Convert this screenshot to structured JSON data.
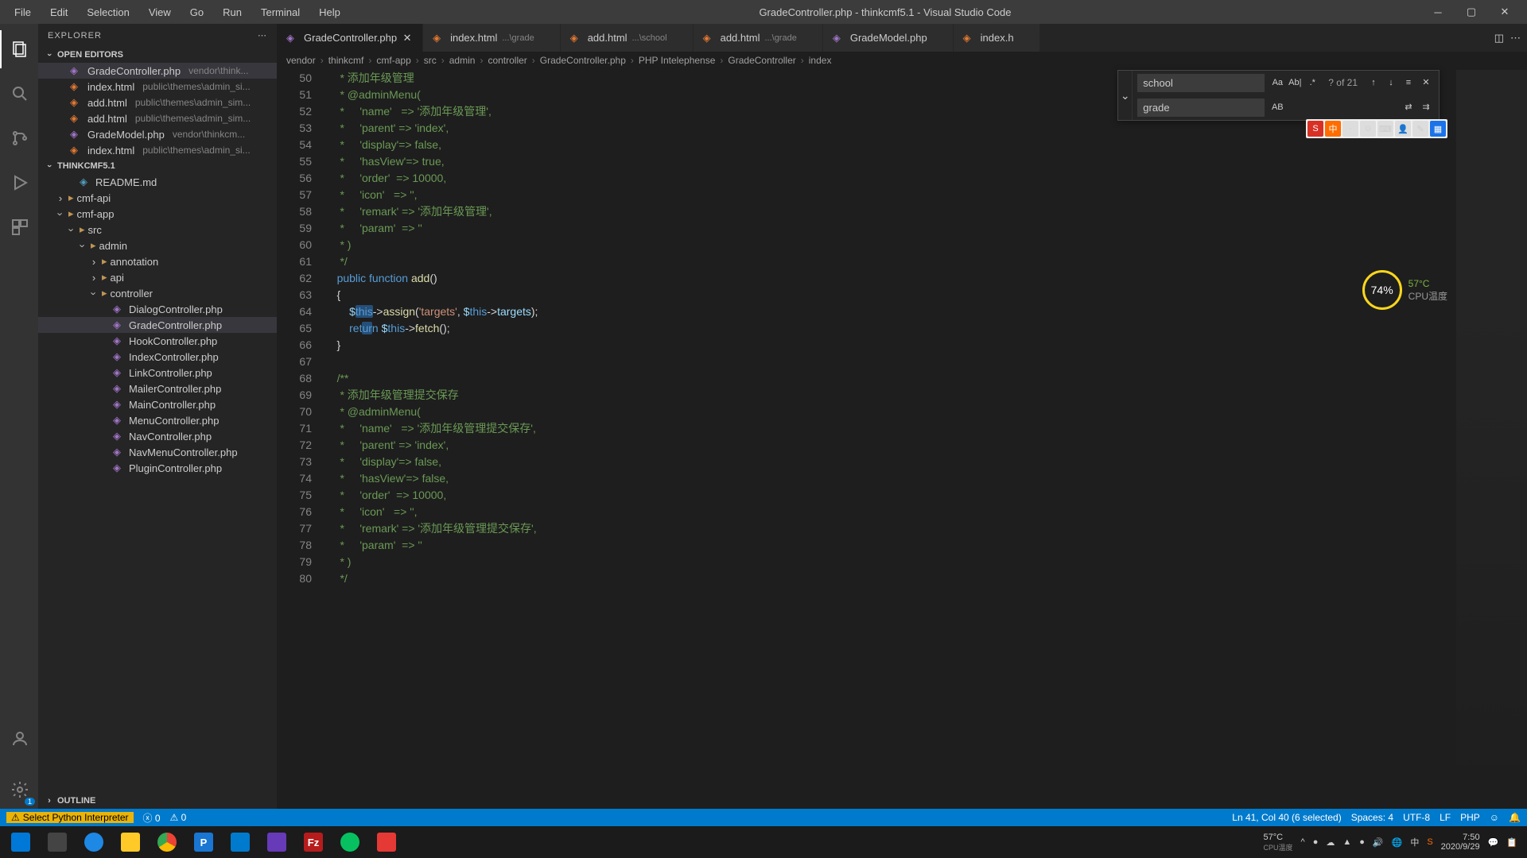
{
  "menubar": [
    "File",
    "Edit",
    "Selection",
    "View",
    "Go",
    "Run",
    "Terminal",
    "Help"
  ],
  "title": "GradeController.php - thinkcmf5.1 - Visual Studio Code",
  "explorer": {
    "header": "EXPLORER",
    "openEditors": "OPEN EDITORS",
    "workspace": "THINKCMF5.1",
    "outline": "OUTLINE",
    "editors": [
      {
        "name": "GradeController.php",
        "path": "vendor\\think...",
        "icon": "php",
        "active": true
      },
      {
        "name": "index.html",
        "path": "public\\themes\\admin_si...",
        "icon": "html"
      },
      {
        "name": "add.html",
        "path": "public\\themes\\admin_sim...",
        "icon": "html"
      },
      {
        "name": "add.html",
        "path": "public\\themes\\admin_sim...",
        "icon": "html"
      },
      {
        "name": "GradeModel.php",
        "path": "vendor\\thinkcm...",
        "icon": "php"
      },
      {
        "name": "index.html",
        "path": "public\\themes\\admin_si...",
        "icon": "html"
      }
    ],
    "tree": [
      {
        "depth": 2,
        "type": "file",
        "name": "README.md",
        "icon": "md"
      },
      {
        "depth": 1,
        "type": "folder",
        "name": "cmf-api",
        "open": false
      },
      {
        "depth": 1,
        "type": "folder",
        "name": "cmf-app",
        "open": true
      },
      {
        "depth": 2,
        "type": "folder",
        "name": "src",
        "open": true
      },
      {
        "depth": 3,
        "type": "folder",
        "name": "admin",
        "open": true
      },
      {
        "depth": 4,
        "type": "folder",
        "name": "annotation",
        "open": false
      },
      {
        "depth": 4,
        "type": "folder",
        "name": "api",
        "open": false
      },
      {
        "depth": 4,
        "type": "folder",
        "name": "controller",
        "open": true
      },
      {
        "depth": 5,
        "type": "file",
        "name": "DialogController.php",
        "icon": "php"
      },
      {
        "depth": 5,
        "type": "file",
        "name": "GradeController.php",
        "icon": "php",
        "selected": true
      },
      {
        "depth": 5,
        "type": "file",
        "name": "HookController.php",
        "icon": "php"
      },
      {
        "depth": 5,
        "type": "file",
        "name": "IndexController.php",
        "icon": "php"
      },
      {
        "depth": 5,
        "type": "file",
        "name": "LinkController.php",
        "icon": "php"
      },
      {
        "depth": 5,
        "type": "file",
        "name": "MailerController.php",
        "icon": "php"
      },
      {
        "depth": 5,
        "type": "file",
        "name": "MainController.php",
        "icon": "php"
      },
      {
        "depth": 5,
        "type": "file",
        "name": "MenuController.php",
        "icon": "php"
      },
      {
        "depth": 5,
        "type": "file",
        "name": "NavController.php",
        "icon": "php"
      },
      {
        "depth": 5,
        "type": "file",
        "name": "NavMenuController.php",
        "icon": "php"
      },
      {
        "depth": 5,
        "type": "file",
        "name": "PluginController.php",
        "icon": "php"
      }
    ]
  },
  "tabs": [
    {
      "name": "GradeController.php",
      "icon": "php",
      "active": true,
      "closable": true
    },
    {
      "name": "index.html",
      "path": "...\\grade",
      "icon": "html"
    },
    {
      "name": "add.html",
      "path": "...\\school",
      "icon": "html"
    },
    {
      "name": "add.html",
      "path": "...\\grade",
      "icon": "html"
    },
    {
      "name": "GradeModel.php",
      "icon": "php"
    },
    {
      "name": "index.h",
      "icon": "html"
    }
  ],
  "breadcrumbs": [
    "vendor",
    "thinkcmf",
    "cmf-app",
    "src",
    "admin",
    "controller",
    "GradeController.php",
    "PHP Intelephense",
    "GradeController",
    "index"
  ],
  "find": {
    "search": "school",
    "replace": "grade",
    "count": "? of 21",
    "caseIcon": "Aa",
    "wordIcon": "Ab|",
    "regexIcon": ".*",
    "preserveIcon": "AB"
  },
  "code": {
    "startLine": 50,
    "lines": [
      {
        "n": 50,
        "html": "     <span class='tok-comment'>* 添加年级管理</span>"
      },
      {
        "n": 51,
        "html": "     <span class='tok-comment'>* @adminMenu(</span>"
      },
      {
        "n": 52,
        "html": "     <span class='tok-comment'>*     'name'   =&gt; '添加年级管理',</span>"
      },
      {
        "n": 53,
        "html": "     <span class='tok-comment'>*     'parent' =&gt; 'index',</span>"
      },
      {
        "n": 54,
        "html": "     <span class='tok-comment'>*     'display'=&gt; false,</span>"
      },
      {
        "n": 55,
        "html": "     <span class='tok-comment'>*     'hasView'=&gt; true,</span>"
      },
      {
        "n": 56,
        "html": "     <span class='tok-comment'>*     'order'  =&gt; 10000,</span>"
      },
      {
        "n": 57,
        "html": "     <span class='tok-comment'>*     'icon'   =&gt; '',</span>"
      },
      {
        "n": 58,
        "html": "     <span class='tok-comment'>*     'remark' =&gt; '添加年级管理',</span>"
      },
      {
        "n": 59,
        "html": "     <span class='tok-comment'>*     'param'  =&gt; ''</span>"
      },
      {
        "n": 60,
        "html": "     <span class='tok-comment'>* )</span>"
      },
      {
        "n": 61,
        "html": "     <span class='tok-comment'>*/</span>"
      },
      {
        "n": 62,
        "html": "    <span class='tok-keyword'>public</span> <span class='tok-keyword'>function</span> <span class='tok-func'>add</span>()"
      },
      {
        "n": 63,
        "html": "    {"
      },
      {
        "n": 64,
        "html": "        <span class='tok-var'>$</span><span class='sel-highlight tok-this'>this</span>-&gt;<span class='tok-func'>assign</span>(<span class='tok-string'>'targets'</span>, <span class='tok-var'>$</span><span class='tok-this'>this</span>-&gt;<span class='tok-var'>targets</span>);"
      },
      {
        "n": 65,
        "html": "        <span class='tok-keyword'>ret</span><span class='sel-highlight tok-keyword'>ur</span><span class='tok-keyword'>n</span> <span class='tok-var'>$</span><span class='tok-this'>this</span>-&gt;<span class='tok-func'>fetch</span>();"
      },
      {
        "n": 66,
        "html": "    }"
      },
      {
        "n": 67,
        "html": ""
      },
      {
        "n": 68,
        "html": "    <span class='tok-comment'>/**</span>"
      },
      {
        "n": 69,
        "html": "     <span class='tok-comment'>* 添加年级管理提交保存</span>"
      },
      {
        "n": 70,
        "html": "     <span class='tok-comment'>* @adminMenu(</span>"
      },
      {
        "n": 71,
        "html": "     <span class='tok-comment'>*     'name'   =&gt; '添加年级管理提交保存',</span>"
      },
      {
        "n": 72,
        "html": "     <span class='tok-comment'>*     'parent' =&gt; 'index',</span>"
      },
      {
        "n": 73,
        "html": "     <span class='tok-comment'>*     'display'=&gt; false,</span>"
      },
      {
        "n": 74,
        "html": "     <span class='tok-comment'>*     'hasView'=&gt; false,</span>"
      },
      {
        "n": 75,
        "html": "     <span class='tok-comment'>*     'order'  =&gt; 10000,</span>"
      },
      {
        "n": 76,
        "html": "     <span class='tok-comment'>*     'icon'   =&gt; '',</span>"
      },
      {
        "n": 77,
        "html": "     <span class='tok-comment'>*     'remark' =&gt; '添加年级管理提交保存',</span>"
      },
      {
        "n": 78,
        "html": "     <span class='tok-comment'>*     'param'  =&gt; ''</span>"
      },
      {
        "n": 79,
        "html": "     <span class='tok-comment'>* )</span>"
      },
      {
        "n": 80,
        "html": "     <span class='tok-comment'>*/</span>"
      }
    ]
  },
  "cpu": {
    "percent": "74%",
    "temp": "57°C",
    "label": "CPU温度"
  },
  "status": {
    "warn": "Select Python Interpreter",
    "errors": "0",
    "warnings": "0",
    "pos": "Ln 41, Col 40 (6 selected)",
    "spaces": "Spaces: 4",
    "enc": "UTF-8",
    "eol": "LF",
    "lang": "PHP"
  },
  "tray": {
    "temp": "57°C",
    "tempLabel": "CPU温度",
    "time": "7:50",
    "date": "2020/9/29"
  }
}
